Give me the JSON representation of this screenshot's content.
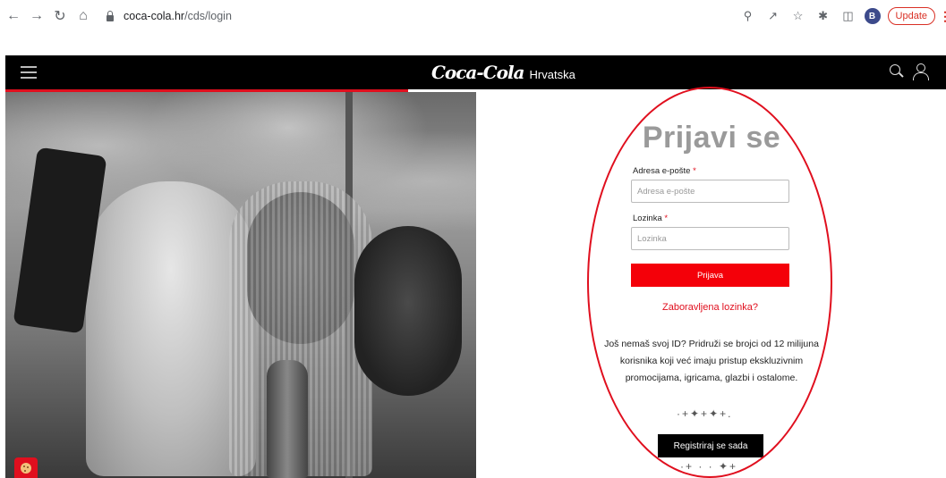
{
  "browser": {
    "url_host": "coca-cola.hr",
    "url_path": "/cds/login",
    "avatar_letter": "B",
    "update_label": "Update",
    "icons": [
      "back-icon",
      "forward-icon",
      "reload-icon",
      "home-icon",
      "lock-icon",
      "zoom-icon",
      "share-icon",
      "star-icon",
      "extensions-icon",
      "sidepanel-icon",
      "menu-icon"
    ]
  },
  "header": {
    "logo_text": "Coca-Cola",
    "country": "Hrvatska"
  },
  "login": {
    "title": "Prijavi se",
    "email_label": "Adresa e-pošte",
    "email_placeholder": "Adresa e-pošte",
    "password_label": "Lozinka",
    "password_placeholder": "Lozinka",
    "required_mark": "*",
    "submit_label": "Prijava",
    "forgot_label": "Zaboravljena lozinka?",
    "promo_text": "Još nemaš svoj ID? Pridruži se brojci od 12 milijuna korisnika koji već imaju pristup ekskluzivnim promocijama, igricama, glazbi i ostalome.",
    "register_label": "Registriraj se sada"
  },
  "colors": {
    "brand_red": "#e00f1e",
    "header_bg": "#000000",
    "annotation_ellipse": "#e00f1e"
  }
}
